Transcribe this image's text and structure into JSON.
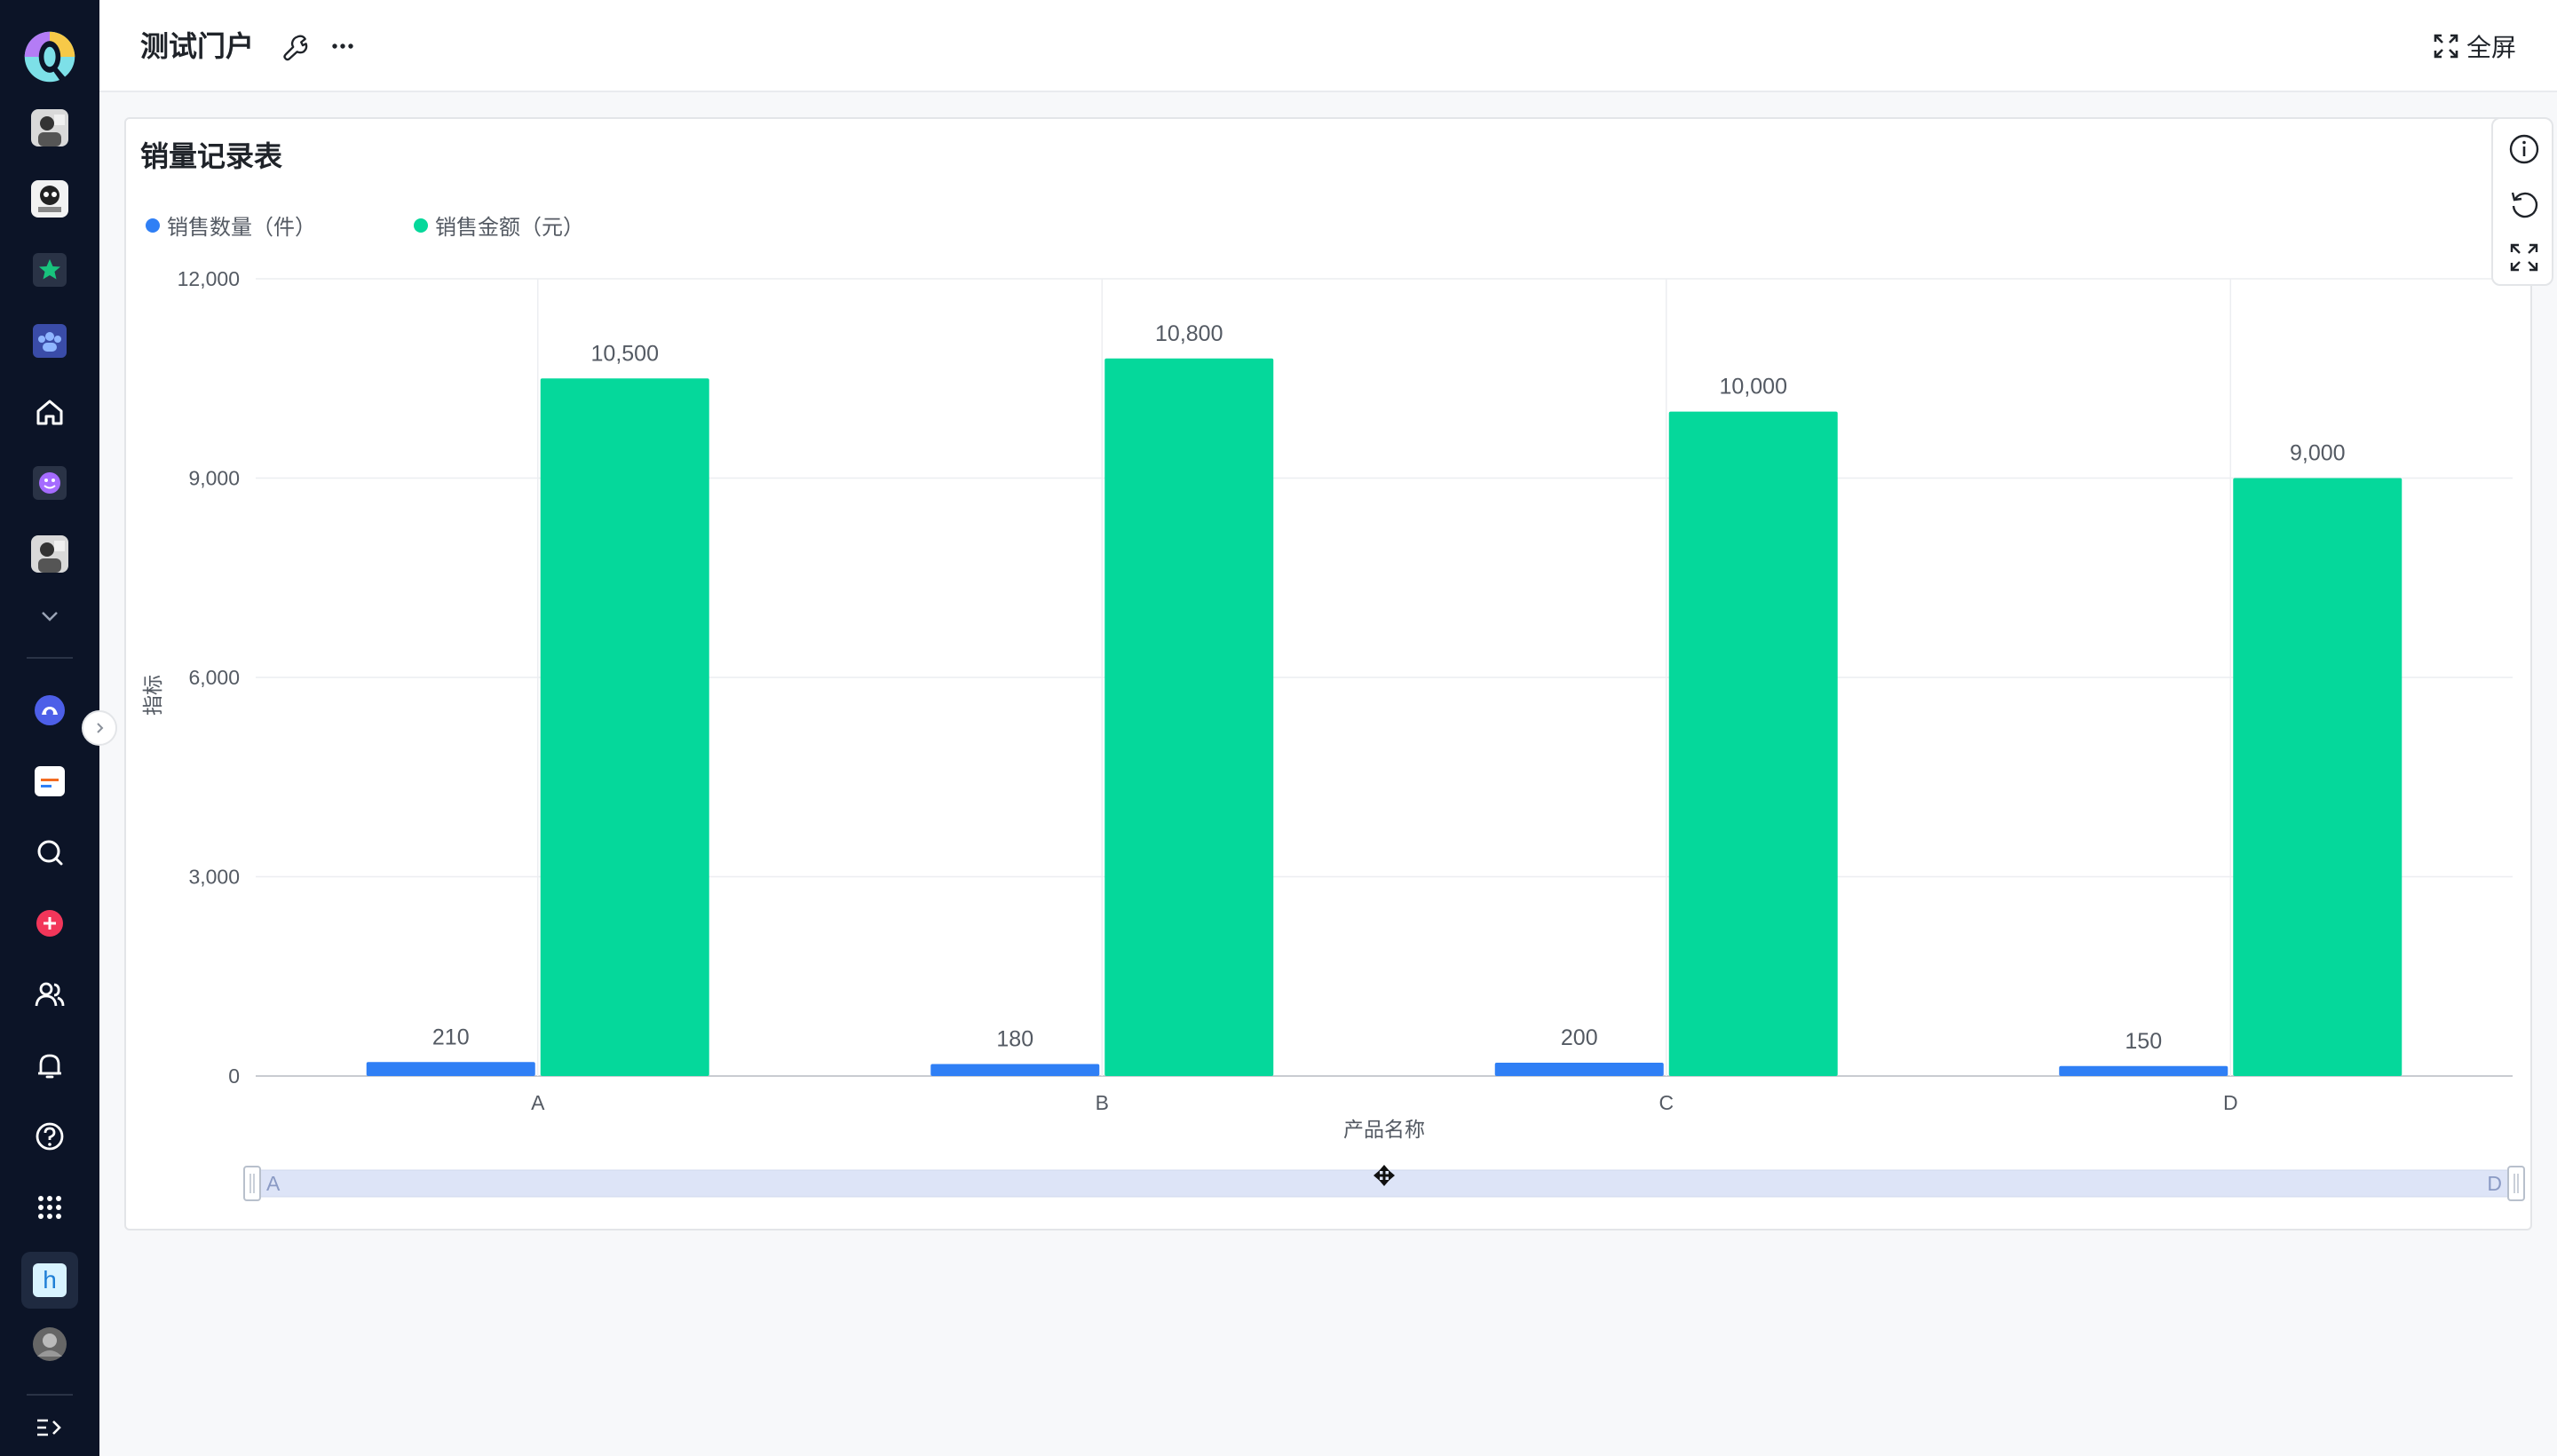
{
  "header": {
    "title": "测试门户",
    "fullscreen_label": "全屏"
  },
  "sidebar": {
    "items": [
      {
        "name": "logo",
        "icon": "app-logo-icon"
      },
      {
        "name": "avatar-1",
        "icon": "avatar-icon"
      },
      {
        "name": "avatar-2",
        "icon": "avatar-icon"
      },
      {
        "name": "star",
        "icon": "star-icon"
      },
      {
        "name": "team",
        "icon": "team-icon"
      },
      {
        "name": "home",
        "icon": "home-icon"
      },
      {
        "name": "emoji",
        "icon": "emoji-icon"
      },
      {
        "name": "avatar-3",
        "icon": "avatar-icon"
      },
      {
        "name": "expand-more",
        "icon": "chevron-down-icon"
      },
      {
        "name": "app-1",
        "icon": "cloud-app-icon"
      },
      {
        "name": "app-2",
        "icon": "document-app-icon"
      },
      {
        "name": "search",
        "icon": "search-icon"
      },
      {
        "name": "add",
        "icon": "plus-icon"
      },
      {
        "name": "contacts",
        "icon": "people-icon"
      },
      {
        "name": "notifications",
        "icon": "bell-icon"
      },
      {
        "name": "help",
        "icon": "help-icon"
      },
      {
        "name": "apps",
        "icon": "grid-icon"
      },
      {
        "name": "h-app",
        "icon": "h-app-icon",
        "text": "h"
      },
      {
        "name": "user-avatar",
        "icon": "avatar-icon"
      },
      {
        "name": "collapse-sidebar",
        "icon": "collapse-icon"
      }
    ]
  },
  "card": {
    "title": "销量记录表"
  },
  "colors": {
    "series1": "#2f7ff5",
    "series2": "#05d89b",
    "sidebar_bg": "#0c1427",
    "accent_red": "#f2365a"
  },
  "chart_data": {
    "type": "bar",
    "categories": [
      "A",
      "B",
      "C",
      "D"
    ],
    "series": [
      {
        "name": "销售数量（件）",
        "values": [
          210,
          180,
          200,
          150
        ],
        "labels": [
          "210",
          "180",
          "200",
          "150"
        ]
      },
      {
        "name": "销售金额（元）",
        "values": [
          10500,
          10800,
          10000,
          9000
        ],
        "labels": [
          "10,500",
          "10,800",
          "10,000",
          "9,000"
        ]
      }
    ],
    "xlabel": "产品名称",
    "ylabel": "指标",
    "ylim": [
      0,
      12000
    ],
    "yticks": [
      0,
      3000,
      6000,
      9000,
      12000
    ],
    "ytick_labels": [
      "0",
      "3,000",
      "6,000",
      "9,000",
      "12,000"
    ],
    "grid": true,
    "legend_position": "top-left",
    "slider": {
      "start_label": "A",
      "end_label": "D"
    }
  }
}
